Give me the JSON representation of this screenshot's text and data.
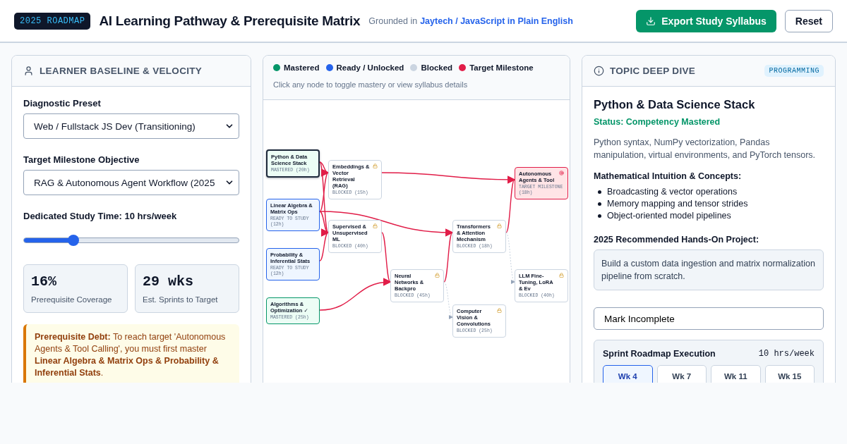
{
  "header": {
    "badge": "2025 ROADMAP",
    "title": "AI Learning Pathway & Prerequisite Matrix",
    "source_prefix": "Grounded in",
    "source_link": "Jaytech / JavaScript in Plain English",
    "export_button": "Export Study Syllabus",
    "reset_button": "Reset"
  },
  "baseline": {
    "title": "LEARNER BASELINE & VELOCITY",
    "preset_label": "Diagnostic Preset",
    "preset_value": "Web / Fullstack JS Dev (Transitioning)",
    "target_label": "Target Milestone Objective",
    "target_value": "RAG & Autonomous Agent Workflow (2025",
    "study_label": "Dedicated Study Time: 10 hrs/week",
    "study": {
      "level": 0.23
    },
    "stats": [
      {
        "value": "16%",
        "label": "Prerequisite Coverage"
      },
      {
        "value": "29 wks",
        "label": "Est. Sprints to Target"
      }
    ],
    "alert": "**Prerequisite Debt:** To reach target 'Autonomous Agents & Tool Calling', you must first master **Linear Algebra & Matrix Ops & Probability & Inferential Stats**."
  },
  "graph": {
    "legend": [
      {
        "label": "Mastered",
        "color": "#059669"
      },
      {
        "label": "Ready / Unlocked",
        "color": "#2563eb"
      },
      {
        "label": "Blocked",
        "color": "#cbd5e1"
      },
      {
        "label": "Target Milestone",
        "color": "#e11d48"
      }
    ],
    "hint": "Click any node to toggle mastery or view syllabus details",
    "nodes": [
      {
        "title": "Python & Data Science Stack",
        "status": "MASTERED (20h)",
        "kind": "mastered",
        "selected": true
      },
      {
        "title": "Linear Algebra & Matrix Ops",
        "status": "READY TO STUDY (12h)",
        "kind": "ready",
        "selected": false
      },
      {
        "title": "Probability & Inferential Stats",
        "status": "READY TO STUDY (12h)",
        "kind": "ready",
        "selected": false
      },
      {
        "title": "Algorithms & Optimization ✓",
        "status": "MASTERED (25h)",
        "kind": "mastered",
        "selected": false
      },
      {
        "title": "Embeddings & Vector Retrieval (RAG)",
        "status": "BLOCKED (15h)",
        "kind": "blocked",
        "selected": false
      },
      {
        "title": "Supervised & Unsupervised ML",
        "status": "BLOCKED (40h)",
        "kind": "blocked",
        "selected": false
      },
      {
        "title": "Neural Networks & Backpro",
        "status": "BLOCKED (45h)",
        "kind": "blocked",
        "selected": false
      },
      {
        "title": "Transformers & Attention Mechanism",
        "status": "BLOCKED (18h)",
        "kind": "blocked",
        "selected": false
      },
      {
        "title": "Computer Vision & Convolutions",
        "status": "BLOCKED (25h)",
        "kind": "blocked",
        "selected": false
      },
      {
        "title": "Autonomous Agents & Tool",
        "status": "TARGET MILESTONE (18h)",
        "kind": "target",
        "selected": false
      },
      {
        "title": "LLM Fine-Tuning, LoRA & Ev",
        "status": "BLOCKED (40h)",
        "kind": "blocked",
        "selected": false
      }
    ]
  },
  "detail": {
    "title": "TOPIC DEEP DIVE",
    "badge": "PROGRAMMING",
    "topic": "Python & Data Science Stack",
    "status": "Status: Competency Mastered",
    "description": "Python syntax, NumPy vectorization, Pandas manipulation, virtual environments, and PyTorch tensors.",
    "concepts_label": "Mathematical Intuition & Concepts:",
    "concepts": [
      "Broadcasting & vector operations",
      "Memory mapping and tensor strides",
      "Object-oriented model pipelines"
    ],
    "project_label": "2025 Recommended Hands-On Project:",
    "project": "Build a custom data ingestion and matrix normalization pipeline from scratch.",
    "toggle_button": "Mark Incomplete",
    "sprint": {
      "title": "Sprint Roadmap Execution",
      "rate": "10 hrs/week",
      "weeks": [
        {
          "label": "Wk 4",
          "selected": true
        },
        {
          "label": "Wk 7",
          "selected": false
        },
        {
          "label": "Wk 11",
          "selected": false
        },
        {
          "label": "Wk 15",
          "selected": false
        }
      ]
    }
  }
}
